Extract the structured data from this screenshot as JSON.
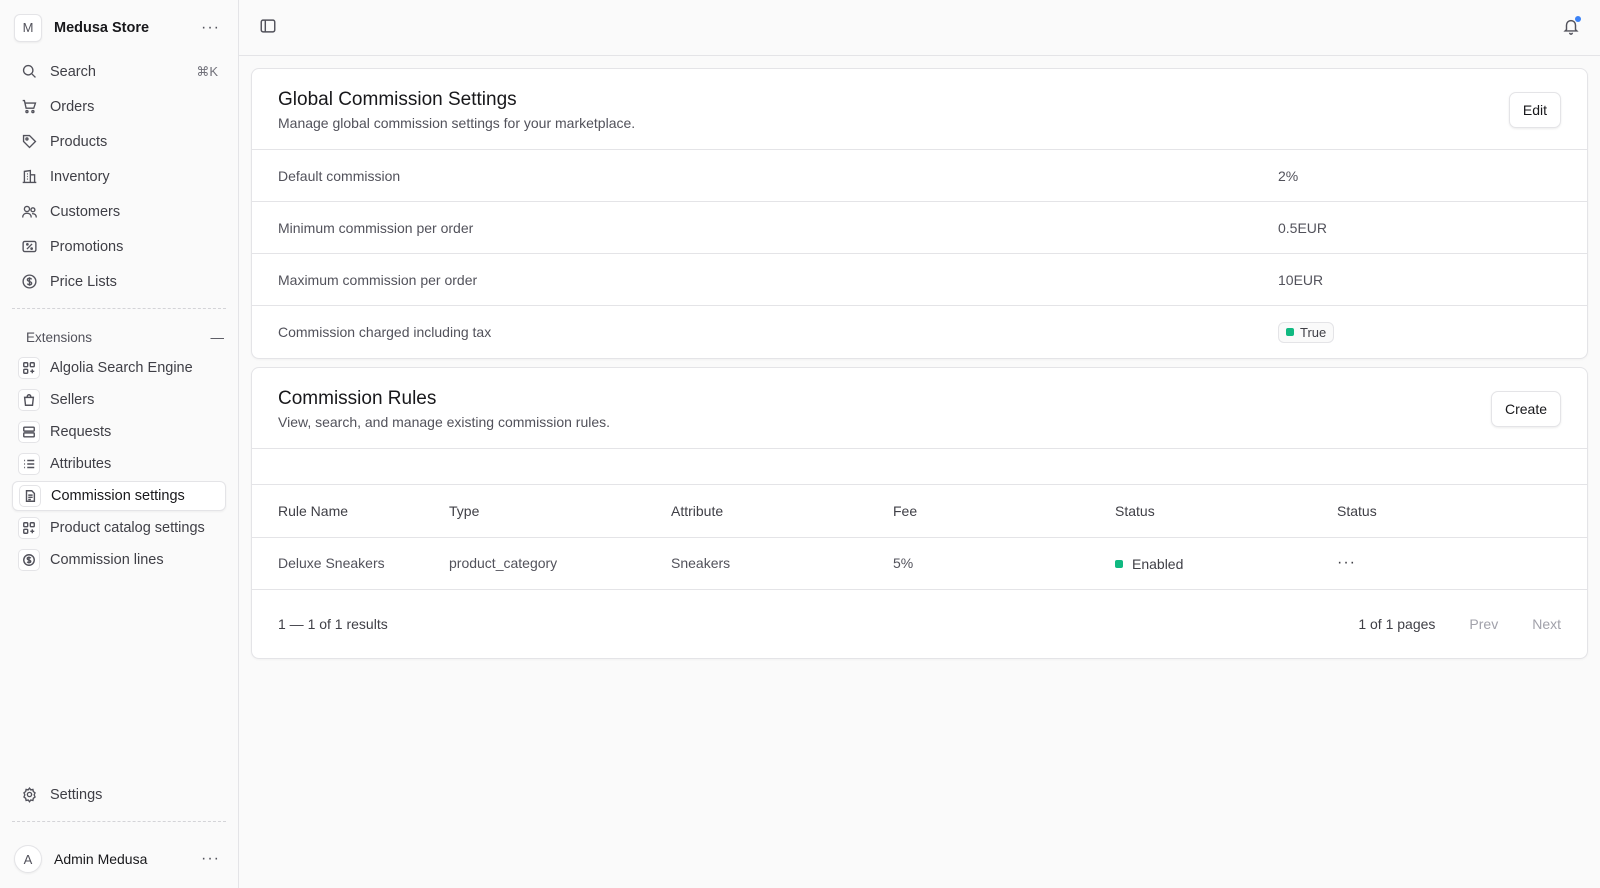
{
  "sidebar": {
    "store_initial": "M",
    "store_name": "Medusa Store",
    "menu_dots": "···",
    "search": {
      "label": "Search",
      "shortcut": "⌘K"
    },
    "nav": [
      {
        "label": "Orders",
        "icon": "cart-icon"
      },
      {
        "label": "Products",
        "icon": "tag-icon"
      },
      {
        "label": "Inventory",
        "icon": "building-icon"
      },
      {
        "label": "Customers",
        "icon": "users-icon"
      },
      {
        "label": "Promotions",
        "icon": "receipt-icon"
      },
      {
        "label": "Price Lists",
        "icon": "currency-icon"
      }
    ],
    "extensions_label": "Extensions",
    "extensions": [
      {
        "label": "Algolia Search Engine",
        "icon": "grid-plus-icon"
      },
      {
        "label": "Sellers",
        "icon": "shopping-bag-icon"
      },
      {
        "label": "Requests",
        "icon": "server-icon"
      },
      {
        "label": "Attributes",
        "icon": "list-icon"
      },
      {
        "label": "Commission settings",
        "icon": "document-icon",
        "active": true
      },
      {
        "label": "Product catalog settings",
        "icon": "grid-plus-icon"
      },
      {
        "label": "Commission lines",
        "icon": "currency-icon"
      }
    ],
    "settings_label": "Settings",
    "user_initial": "A",
    "user_name": "Admin Medusa"
  },
  "global_settings": {
    "title": "Global Commission Settings",
    "subtitle": "Manage global commission settings for your marketplace.",
    "edit_label": "Edit",
    "rows": [
      {
        "key": "Default commission",
        "value": "2%"
      },
      {
        "key": "Minimum commission per order",
        "value": "0.5EUR"
      },
      {
        "key": "Maximum commission per order",
        "value": "10EUR"
      },
      {
        "key": "Commission charged including tax",
        "value": "True",
        "badge_color": "#10b981"
      }
    ]
  },
  "rules": {
    "title": "Commission Rules",
    "subtitle": "View, search, and manage existing commission rules.",
    "create_label": "Create",
    "columns": [
      "Rule Name",
      "Type",
      "Attribute",
      "Fee",
      "Status",
      "Status"
    ],
    "rows": [
      {
        "name": "Deluxe Sneakers",
        "type": "product_category",
        "attribute": "Sneakers",
        "fee": "5%",
        "status": "Enabled",
        "status_color": "#10b981",
        "actions": "···"
      }
    ],
    "pagination": {
      "results": "1 — 1 of 1 results",
      "pages": "1 of 1 pages",
      "prev": "Prev",
      "next": "Next"
    }
  }
}
